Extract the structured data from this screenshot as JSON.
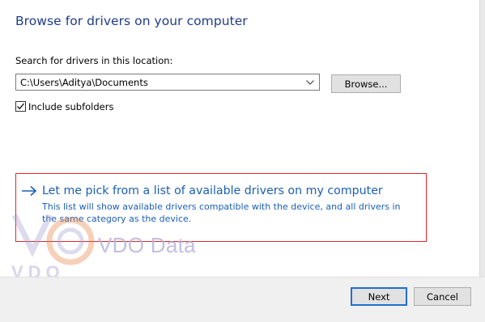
{
  "header": {
    "title": "Browse for drivers on your computer"
  },
  "search": {
    "label": "Search for drivers in this location:",
    "path_value": "C:\\Users\\Aditya\\Documents",
    "browse_label": "Browse..."
  },
  "options": {
    "include_subfolders_label": "Include subfolders",
    "include_subfolders_checked": true
  },
  "pick_option": {
    "title": "Let me pick from a list of available drivers on my computer",
    "description": "This list will show available drivers compatible with the device, and all drivers in the same category as the device."
  },
  "watermark": {
    "logo_text": "VDO",
    "text": "VDO Data"
  },
  "footer": {
    "next_label": "Next",
    "cancel_label": "Cancel"
  },
  "colors": {
    "title_blue": "#1f3c88",
    "link_blue": "#1a5fb4",
    "highlight_red": "#e0252b",
    "default_button_border": "#1f6fd1"
  }
}
